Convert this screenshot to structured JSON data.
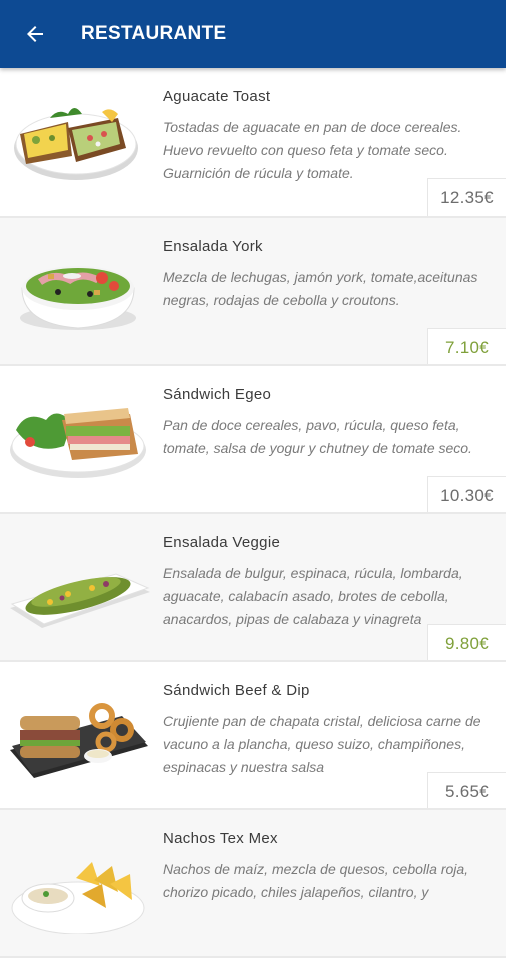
{
  "header": {
    "title": "RESTAURANTE",
    "back_icon": "arrow-left-icon",
    "background": "#0d4a93"
  },
  "colors": {
    "price_default": "#6d6d6d",
    "price_highlight": "#7fa03a"
  },
  "items": [
    {
      "name": "Aguacate Toast",
      "description": "Tostadas de aguacate en pan de doce cereales. Huevo revuelto con queso feta y tomate seco. Guarnición de rúcula y tomate.",
      "price": "12.35€"
    },
    {
      "name": "Ensalada York",
      "description": "Mezcla de lechugas, jamón york, tomate,aceitunas negras, rodajas de cebolla y croutons.",
      "price": "7.10€"
    },
    {
      "name": "Sándwich Egeo",
      "description": "Pan de doce cereales, pavo, rúcula, queso feta, tomate, salsa de yogur y chutney de tomate seco.",
      "price": "10.30€"
    },
    {
      "name": "Ensalada Veggie",
      "description": "Ensalada de bulgur, espinaca, rúcula, lombarda, aguacate, calabacín asado, brotes de cebolla, anacardos, pipas de calabaza y vinagreta",
      "price": "9.80€"
    },
    {
      "name": "Sándwich Beef & Dip",
      "description": "Crujiente pan de chapata cristal, deliciosa carne de vacuno a la plancha, queso suizo, champiñones, espinacas y nuestra salsa",
      "price": "5.65€"
    },
    {
      "name": "Nachos Tex Mex",
      "description": "Nachos de maíz, mezcla de quesos, cebolla roja, chorizo picado, chiles jalapeños, cilantro, y",
      "price": ""
    }
  ]
}
